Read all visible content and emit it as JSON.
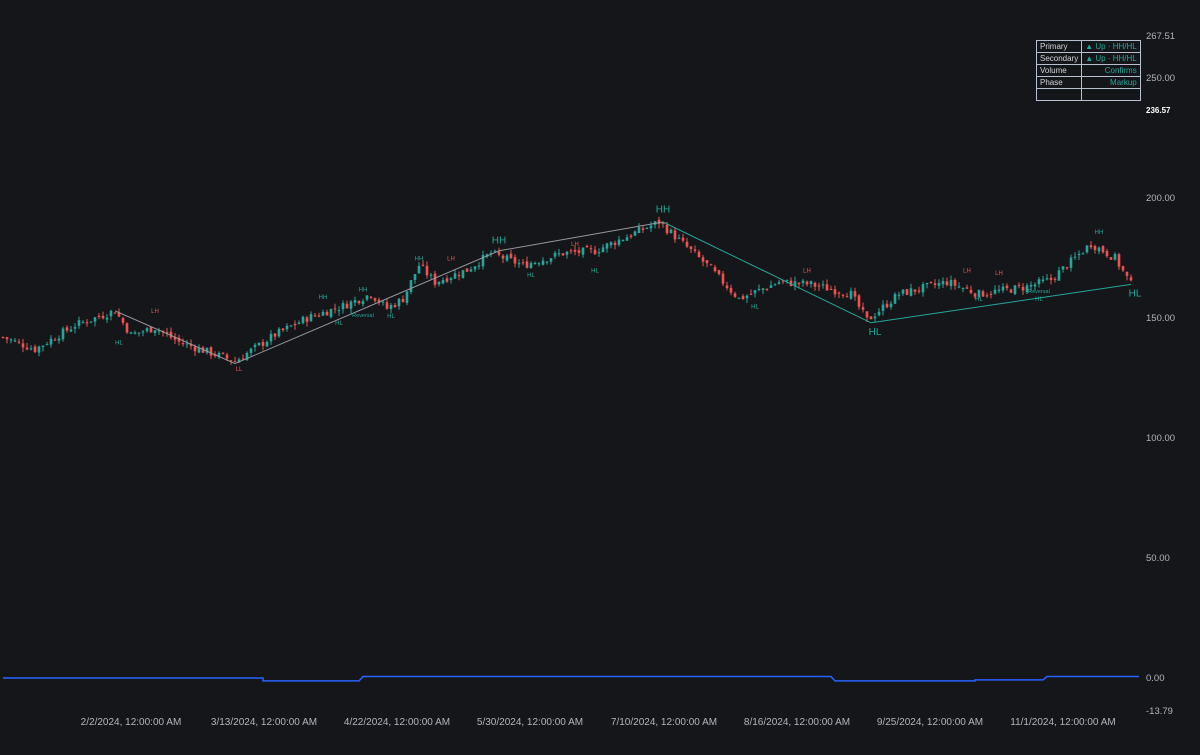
{
  "colors": {
    "background": "#151619",
    "up": "#26a69a",
    "down": "#ef5350",
    "zigzag_main": "#9598a1",
    "zigzag_last": "#26a69a",
    "indicator_line": "#2962ff",
    "axis_text": "#b2b5be",
    "table_value": "#26a69a"
  },
  "status_table": {
    "rows": [
      {
        "label": "Primary",
        "value": "▲ Up · HH/HL"
      },
      {
        "label": "Secondary",
        "value": "▲ Up · HH/HL"
      },
      {
        "label": "Volume",
        "value": "Confirms"
      },
      {
        "label": "Phase",
        "value": "Markup"
      },
      {
        "label": "",
        "value": ""
      }
    ]
  },
  "chart_data": {
    "type": "candlestick",
    "x_axis": {
      "tick_labels": [
        "2/2/2024, 12:00:00 AM",
        "3/13/2024, 12:00:00 AM",
        "4/22/2024, 12:00:00 AM",
        "5/30/2024, 12:00:00 AM",
        "7/10/2024, 12:00:00 AM",
        "8/16/2024, 12:00:00 AM",
        "9/25/2024, 12:00:00 AM",
        "11/1/2024, 12:00:00 AM"
      ]
    },
    "y_axis": {
      "range": [
        -13.79,
        267.51
      ],
      "tick_labels": [
        "267.51",
        "250.00",
        "236.57",
        "200.00",
        "150.00",
        "100.00",
        "50.00",
        "0.00",
        "-13.79"
      ],
      "ticks": [
        267.51,
        250.0,
        236.57,
        200.0,
        150.0,
        100.0,
        50.0,
        0.0,
        -13.79
      ],
      "highlighted_tick": "236.57"
    },
    "price_anchors": [
      {
        "bar": 0,
        "close": 142
      },
      {
        "bar": 8,
        "close": 137
      },
      {
        "bar": 18,
        "close": 147
      },
      {
        "bar": 28,
        "close": 153
      },
      {
        "bar": 32,
        "close": 143
      },
      {
        "bar": 38,
        "close": 146
      },
      {
        "bar": 44,
        "close": 140
      },
      {
        "bar": 58,
        "close": 132
      },
      {
        "bar": 68,
        "close": 143
      },
      {
        "bar": 76,
        "close": 150
      },
      {
        "bar": 85,
        "close": 155
      },
      {
        "bar": 92,
        "close": 160
      },
      {
        "bar": 96,
        "close": 154
      },
      {
        "bar": 100,
        "close": 158
      },
      {
        "bar": 104,
        "close": 172
      },
      {
        "bar": 108,
        "close": 165
      },
      {
        "bar": 116,
        "close": 170
      },
      {
        "bar": 122,
        "close": 177
      },
      {
        "bar": 130,
        "close": 172
      },
      {
        "bar": 140,
        "close": 177
      },
      {
        "bar": 148,
        "close": 178
      },
      {
        "bar": 156,
        "close": 184
      },
      {
        "bar": 164,
        "close": 190
      },
      {
        "bar": 172,
        "close": 178
      },
      {
        "bar": 176,
        "close": 172
      },
      {
        "bar": 184,
        "close": 158
      },
      {
        "bar": 194,
        "close": 165
      },
      {
        "bar": 202,
        "close": 164
      },
      {
        "bar": 212,
        "close": 160
      },
      {
        "bar": 216,
        "close": 149
      },
      {
        "bar": 224,
        "close": 160
      },
      {
        "bar": 236,
        "close": 165
      },
      {
        "bar": 244,
        "close": 160
      },
      {
        "bar": 256,
        "close": 163
      },
      {
        "bar": 262,
        "close": 166
      },
      {
        "bar": 272,
        "close": 181
      },
      {
        "bar": 278,
        "close": 175
      },
      {
        "bar": 282,
        "close": 164
      }
    ],
    "zigzag": {
      "points": [
        {
          "bar": 28,
          "price": 153
        },
        {
          "bar": 58,
          "price": 131
        },
        {
          "bar": 124,
          "price": 178
        },
        {
          "bar": 165,
          "price": 190
        },
        {
          "bar": 217,
          "price": 148
        },
        {
          "bar": 282,
          "price": 164
        }
      ]
    },
    "swing_labels": [
      {
        "text": "HL",
        "bar": 29,
        "price": 139,
        "kind": "low"
      },
      {
        "text": "LH",
        "bar": 38,
        "price": 152,
        "kind": "high"
      },
      {
        "text": "LL",
        "bar": 59,
        "price": 128,
        "kind": "low"
      },
      {
        "text": "HH",
        "bar": 80,
        "price": 158,
        "kind": "high"
      },
      {
        "text": "HL",
        "bar": 84,
        "price": 147,
        "kind": "low"
      },
      {
        "text": "HH",
        "bar": 90,
        "price": 161,
        "kind": "high"
      },
      {
        "text": "HL",
        "bar": 97,
        "price": 150,
        "kind": "low"
      },
      {
        "text": "HH",
        "bar": 104,
        "price": 174,
        "kind": "high"
      },
      {
        "text": "LH",
        "bar": 112,
        "price": 174,
        "kind": "high"
      },
      {
        "text": "HH",
        "bar": 124,
        "price": 181,
        "kind": "high_big"
      },
      {
        "text": "HL",
        "bar": 132,
        "price": 167,
        "kind": "low"
      },
      {
        "text": "LH",
        "bar": 143,
        "price": 180,
        "kind": "high"
      },
      {
        "text": "HL",
        "bar": 148,
        "price": 169,
        "kind": "low"
      },
      {
        "text": "HH",
        "bar": 165,
        "price": 194,
        "kind": "high_big"
      },
      {
        "text": "HL",
        "bar": 188,
        "price": 154,
        "kind": "low"
      },
      {
        "text": "LH",
        "bar": 201,
        "price": 169,
        "kind": "high"
      },
      {
        "text": "HL",
        "bar": 218,
        "price": 143,
        "kind": "low_big"
      },
      {
        "text": "LH",
        "bar": 241,
        "price": 169,
        "kind": "high"
      },
      {
        "text": "HL",
        "bar": 244,
        "price": 157,
        "kind": "low"
      },
      {
        "text": "LH",
        "bar": 249,
        "price": 168,
        "kind": "high"
      },
      {
        "text": "HL",
        "bar": 259,
        "price": 157,
        "kind": "low"
      },
      {
        "text": "HH",
        "bar": 274,
        "price": 185,
        "kind": "high"
      },
      {
        "text": "HL",
        "bar": 283,
        "price": 159,
        "kind": "low_big"
      }
    ],
    "reversal_labels": [
      {
        "text": "Reversal",
        "bar": 90,
        "price": 150.5
      },
      {
        "text": "Reversal",
        "bar": 259,
        "price": 160.5
      }
    ],
    "indicator": {
      "baseline": 0,
      "segments": [
        {
          "from_bar": 0,
          "to_bar": 65,
          "value": 0
        },
        {
          "from_bar": 65,
          "to_bar": 89,
          "value": -1.2
        },
        {
          "from_bar": 90,
          "to_bar": 207,
          "value": 0.6
        },
        {
          "from_bar": 208,
          "to_bar": 243,
          "value": -1.2
        },
        {
          "from_bar": 243,
          "to_bar": 260,
          "value": -0.8
        },
        {
          "from_bar": 261,
          "to_bar": 284,
          "value": 0.6
        }
      ]
    }
  }
}
